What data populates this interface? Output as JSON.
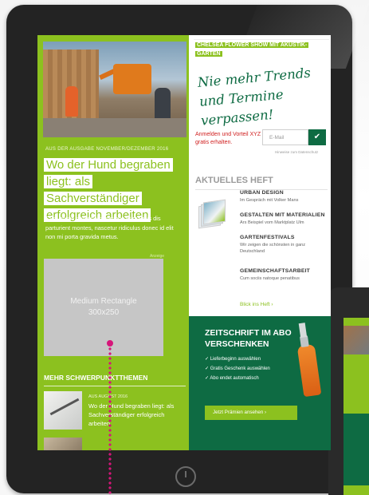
{
  "left": {
    "kicker": "AUS DER AUSGABE NOVEMBER/DEZEMBER 2016",
    "headline": "Wo der Hund begraben liegt: als Sachverständiger erfolgreich arbeiten",
    "teaser": "Cum sociis natoque penatibus et magnis dis parturient montes, nascetur ridiculus donec id elit non mi porta gravida metus.",
    "ad_label": "Anzeige",
    "ad_line1": "Medium Rectangle",
    "ad_line2": "300x250",
    "more_title": "MEHR SCHWERPUNKTTHEMEN",
    "article_meta": "AUS AUGUST 2016",
    "article_title": "Wo der Hund begraben liegt: als Sachverständiger erfolgreich arbeiten"
  },
  "right": {
    "event": "CHELSEA FLOWER SHOW MIT AKUSTIK-GARTEN",
    "slogan": "Nie mehr Trends und Termine verpassen!",
    "newsletter_text": "Anmelden und Vorteil XYZ gratis erhalten.",
    "email_placeholder": "E-Mail",
    "submit_icon": "check-icon",
    "submit_glyph": "✔",
    "privacy_note": "Hinweise zum Datenschutz",
    "current_issue_title": "AKTUELLES HEFT",
    "issues": [
      {
        "title": "URBAN DESIGN",
        "sub": "Im Gespräch mit Volker Mans"
      },
      {
        "title": "GESTALTEN MIT MATERIALIEN",
        "sub": "Ars Beispiel vom Marktplatz Ulm"
      },
      {
        "title": "GARTENFESTIVALS",
        "sub": "Wir zeigen die schönsten in ganz Deutschland"
      },
      {
        "title": "GEMEINSCHAFTSARBEIT",
        "sub": "Cum sociis natoque penatibus"
      }
    ],
    "issue_link": "Blick ins Heft  ›",
    "abo_title": "ZEITSCHRIFT IM ABO VERSCHENKEN",
    "abo_items": [
      "Lieferbeginn auswählen",
      "Gratis Geschenk auswählen",
      "Abo endet automatisch"
    ],
    "abo_button": "Jetzt Prämien ansehen  ›"
  },
  "colors": {
    "brand_green": "#8cc11f",
    "dark_green": "#0e6b43",
    "accent_red": "#d02020",
    "marker_pink": "#d6157a"
  }
}
